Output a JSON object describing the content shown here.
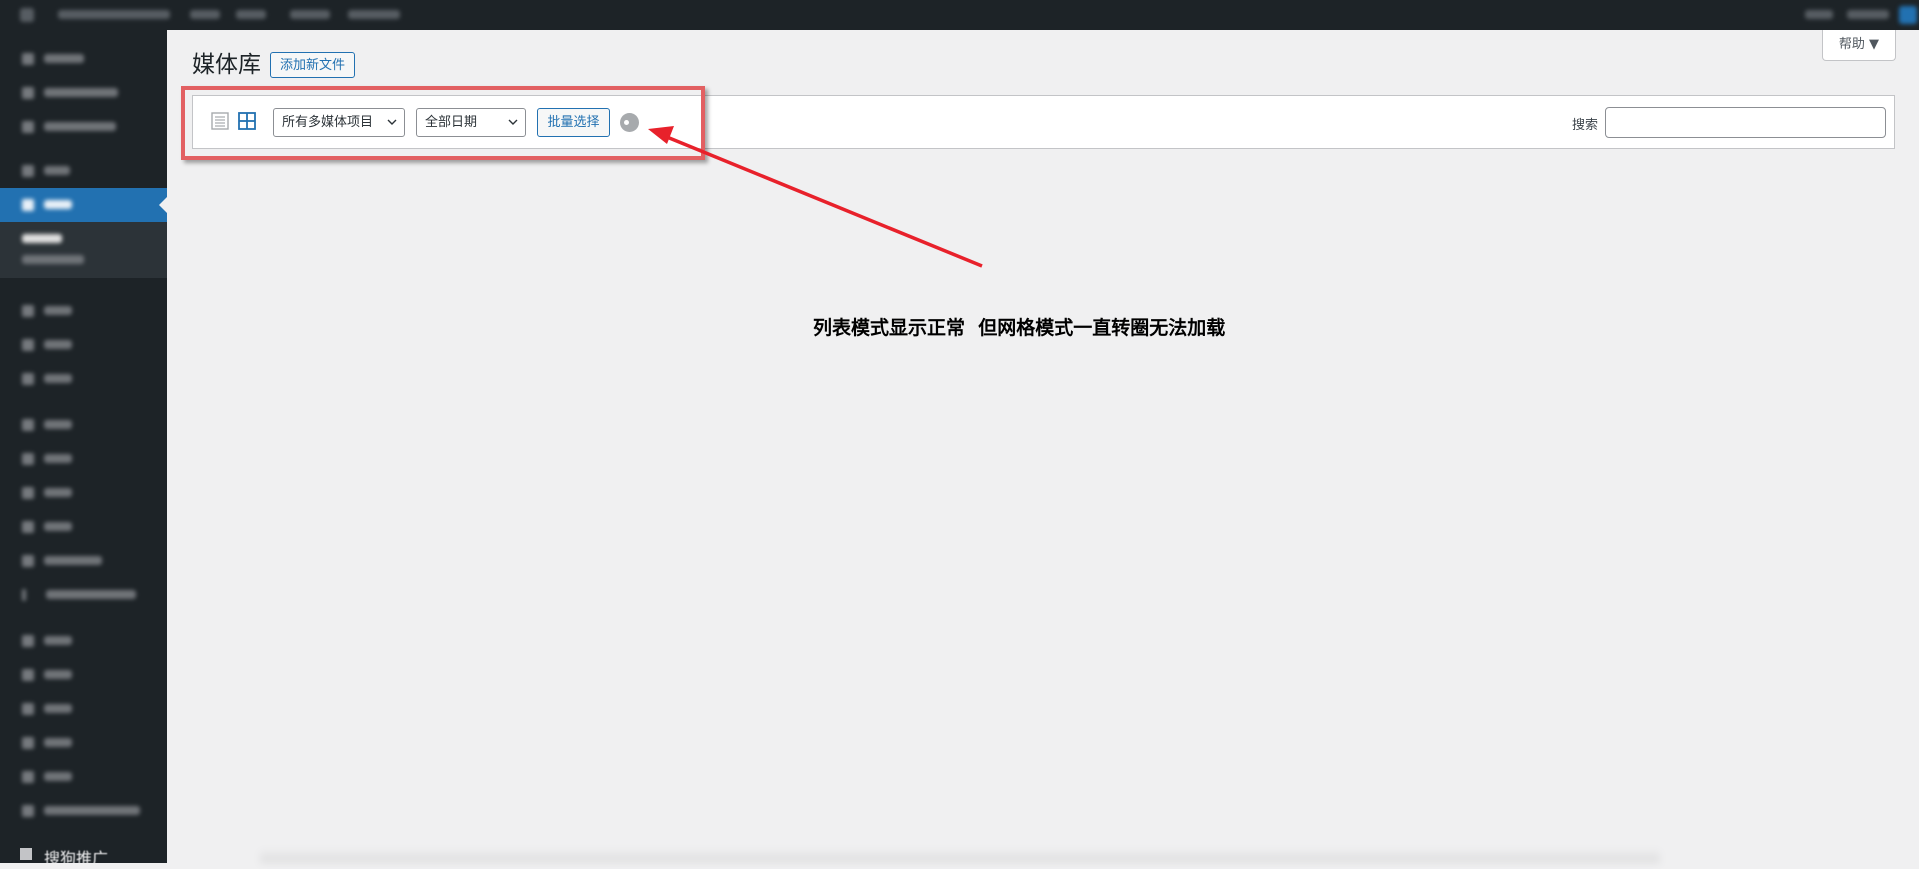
{
  "page": {
    "title": "媒体库",
    "add_new_label": "添加新文件",
    "help_label": "帮助 ▼"
  },
  "toolbar": {
    "view_list_icon": "list-view-icon",
    "view_grid_icon": "grid-view-icon",
    "type_filter_value": "所有多媒体项目",
    "date_filter_value": "全部日期",
    "bulk_select_label": "批量选择",
    "spinner_icon": "loading-spinner-icon",
    "search_label": "搜索",
    "search_value": ""
  },
  "sidebar": {
    "last_item_label": "搜狗推广"
  },
  "annotation": {
    "text": "列表模式显示正常  但网格模式一直转圈无法加载",
    "highlight_color": "#e26062",
    "arrow_color": "#e8212b"
  },
  "colors": {
    "admin_bg": "#1d2327",
    "accent": "#2271b1",
    "page_bg": "#f0f0f1"
  }
}
